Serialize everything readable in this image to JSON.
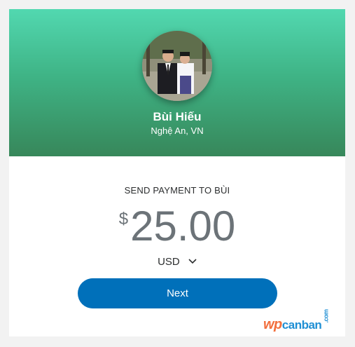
{
  "recipient": {
    "name": "Bùi Hiếu",
    "location": "Nghệ An, VN"
  },
  "payment": {
    "label": "SEND PAYMENT TO BÙI",
    "currency_symbol": "$",
    "amount": "25.00",
    "currency": "USD"
  },
  "actions": {
    "next_label": "Next"
  },
  "watermark": {
    "part1": "wp",
    "part2": "canban",
    "suffix": ".com"
  },
  "colors": {
    "hero_top": "#52d8b0",
    "hero_bottom": "#37875a",
    "button": "#0070ba",
    "amount_text": "#6c7378"
  },
  "icons": {
    "currency_dropdown": "chevron-down-icon"
  }
}
